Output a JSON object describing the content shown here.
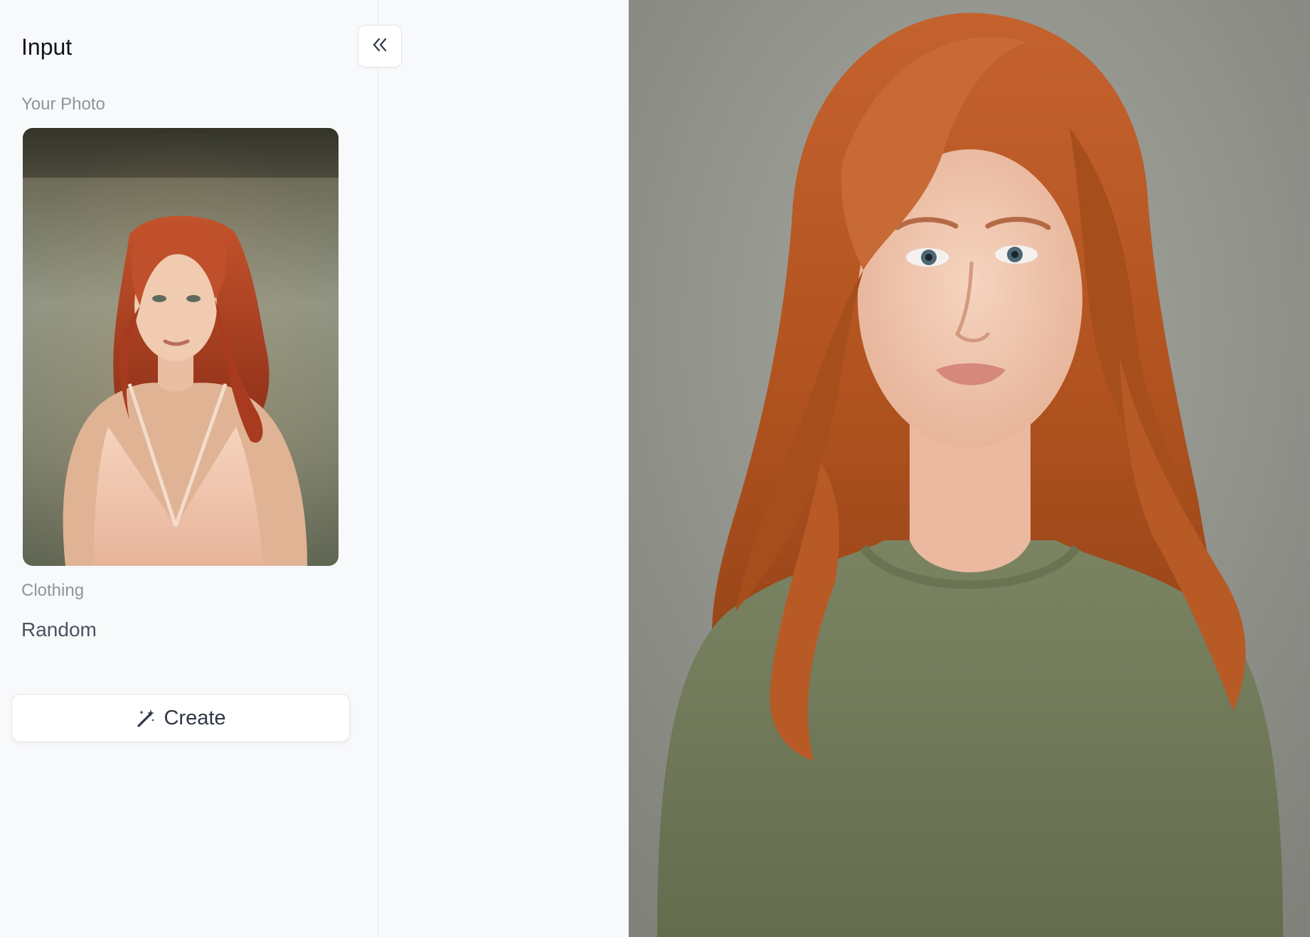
{
  "sidebar": {
    "title": "Input",
    "photo_label": "Your Photo",
    "clothing_label": "Clothing",
    "clothing_value": "Random",
    "create_label": "Create"
  },
  "icons": {
    "collapse": "double-chevron-left-icon",
    "create": "magic-wand-icon"
  },
  "colors": {
    "panel_bg": "#f8f9fb",
    "text_primary": "#111418",
    "text_muted": "#8d949e",
    "output_bg": "#8f9089"
  }
}
